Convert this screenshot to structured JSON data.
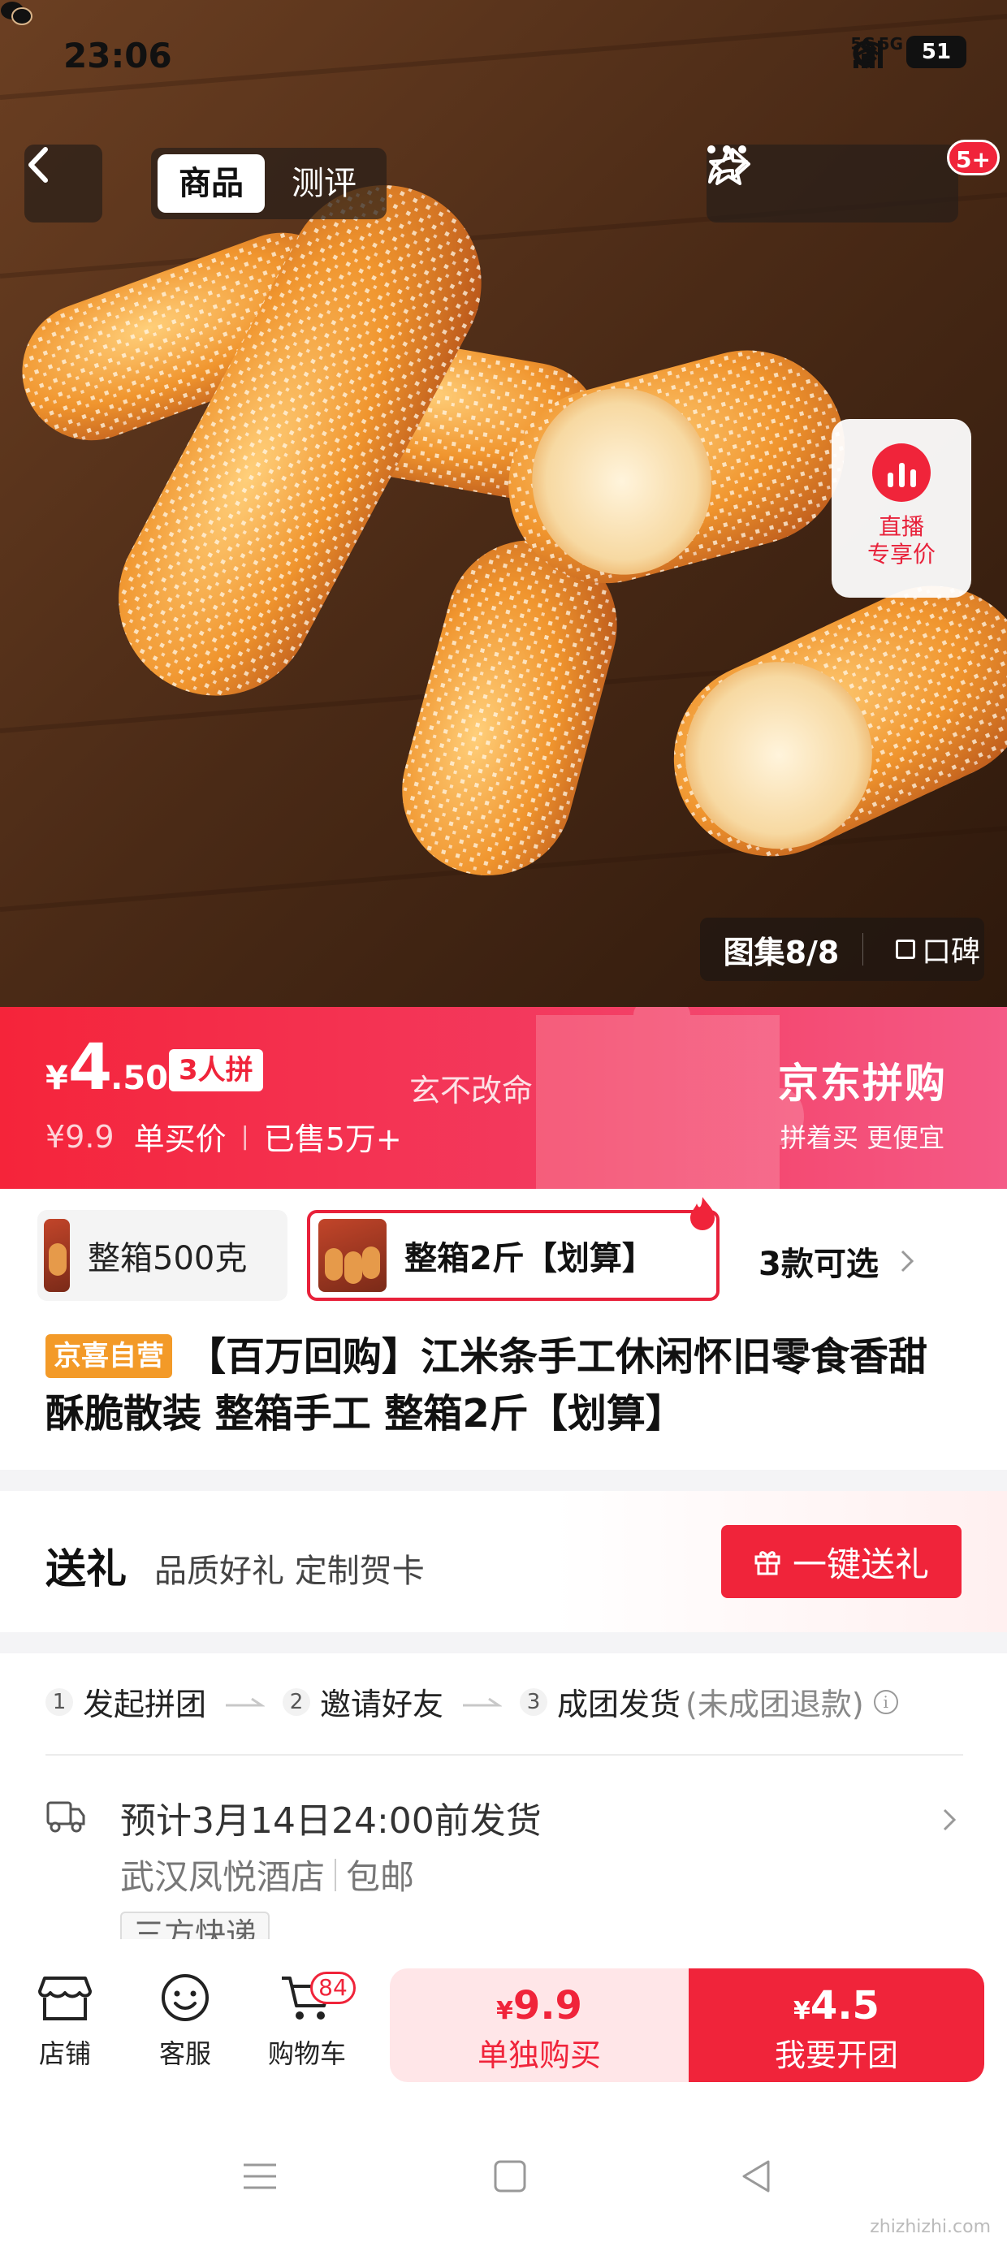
{
  "status_bar": {
    "time": "23:06",
    "network_label_1": "5G",
    "network_label_2": "5G",
    "battery": "51"
  },
  "nav": {
    "tab_product": "商品",
    "tab_review": "测评",
    "badge": "5+"
  },
  "live": {
    "label_line1": "直播",
    "label_line2": "专享价"
  },
  "gallery": {
    "count": "图集8/8",
    "review": "口碑"
  },
  "price_banner": {
    "currency": "¥",
    "price_int": "4",
    "price_dec": ".50",
    "group_tag": "3人拼",
    "slogan": "玄不改命",
    "original_price": "¥9.9",
    "single_label": "单买价",
    "separator": "|",
    "sold": "已售5万+",
    "brand_title": "京东拼购",
    "brand_sub": "拼着买 更便宜",
    "colors": {
      "start": "#f5243a",
      "end": "#f45a86"
    }
  },
  "variants": {
    "items": [
      {
        "label": "整箱500克",
        "selected": false
      },
      {
        "label": "整箱2斤【划算】",
        "selected": true
      }
    ],
    "more": "3款可选"
  },
  "title": {
    "tag": "京喜自营",
    "text": "【百万回购】江米条手工休闲怀旧零食香甜酥脆散装 整箱手工 整箱2斤【划算】"
  },
  "gift": {
    "title": "送礼",
    "subtitle": "品质好礼 定制贺卡",
    "button": "一键送礼"
  },
  "steps": {
    "items": [
      {
        "num": "1",
        "label": "发起拼团"
      },
      {
        "num": "2",
        "label": "邀请好友"
      },
      {
        "num": "3",
        "label": "成团发货"
      }
    ],
    "note": "(未成团退款)",
    "info_icon": "i"
  },
  "shipping": {
    "line1": "预计3月14日24:00前发货",
    "origin": "武汉凤悦酒店",
    "free_ship": "包邮",
    "tag": "三方快递"
  },
  "bottom": {
    "shop": "店铺",
    "service": "客服",
    "cart": "购物车",
    "cart_count": "84",
    "single_price_c": "¥",
    "single_price": "9.9",
    "single_label": "单独购买",
    "group_price_c": "¥",
    "group_price": "4.5",
    "group_label": "我要开团"
  },
  "watermark": "zhizhizhi.com",
  "colors": {
    "accent": "#f0243a",
    "self_tag": "#f39a28"
  }
}
